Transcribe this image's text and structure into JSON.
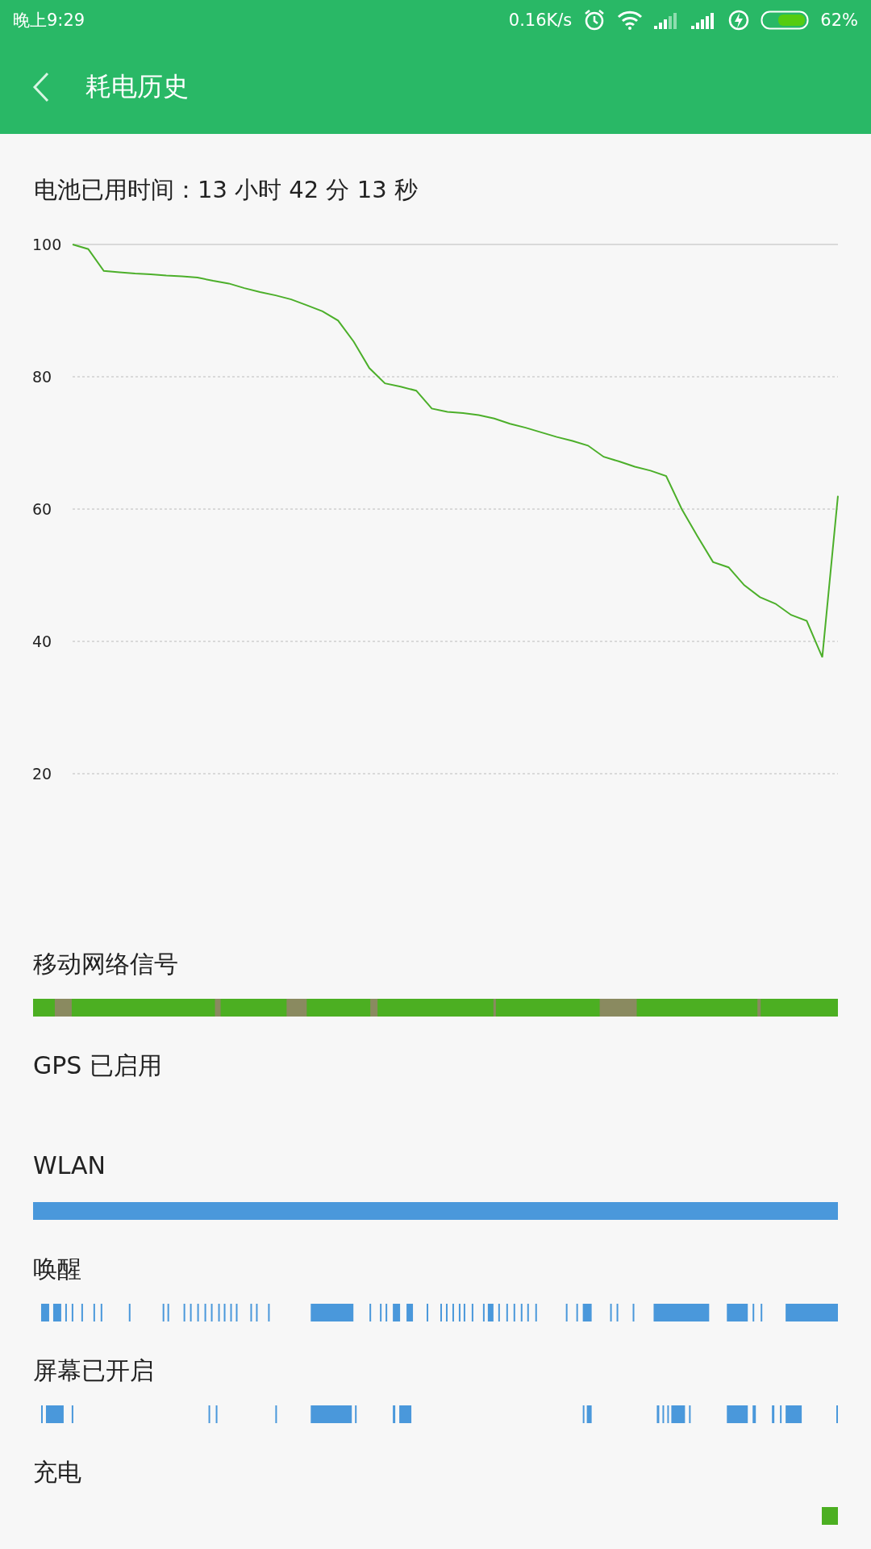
{
  "status_bar": {
    "time": "晚上9:29",
    "speed": "0.16K/s",
    "battery": "62%"
  },
  "app_bar": {
    "title": "耗电历史"
  },
  "usage_time": "电池已用时间：13 小时 42 分 13 秒",
  "chart_data": {
    "type": "line",
    "ylim": [
      20,
      100
    ],
    "yticks": [
      20,
      40,
      60,
      80,
      100
    ],
    "grid": true,
    "series": [
      {
        "color": "#4caf2a",
        "values": [
          100,
          99.3,
          96,
          95.8,
          95.6,
          95.5,
          95.3,
          95.2,
          95,
          94.5,
          94.1,
          93.4,
          92.8,
          92.3,
          91.7,
          90.8,
          89.9,
          88.5,
          85.3,
          81.3,
          79,
          78.5,
          77.9,
          75.2,
          74.7,
          74.5,
          74.2,
          73.7,
          72.9,
          72.3,
          71.6,
          70.9,
          70.3,
          69.6,
          67.9,
          67.2,
          66.4,
          65.8,
          65,
          60,
          55.9,
          52,
          51.2,
          48.5,
          46.7,
          45.7,
          44,
          43.1,
          37.6,
          62
        ]
      }
    ]
  },
  "rows": [
    {
      "label": "移动网络信号",
      "kind": "signal"
    },
    {
      "label": "GPS 已启用",
      "kind": "empty"
    },
    {
      "label": "WLAN",
      "kind": "full"
    },
    {
      "label": "唤醒",
      "kind": "wake"
    },
    {
      "label": "屏幕已开启",
      "kind": "screen"
    },
    {
      "label": "充电",
      "kind": "charging"
    }
  ]
}
